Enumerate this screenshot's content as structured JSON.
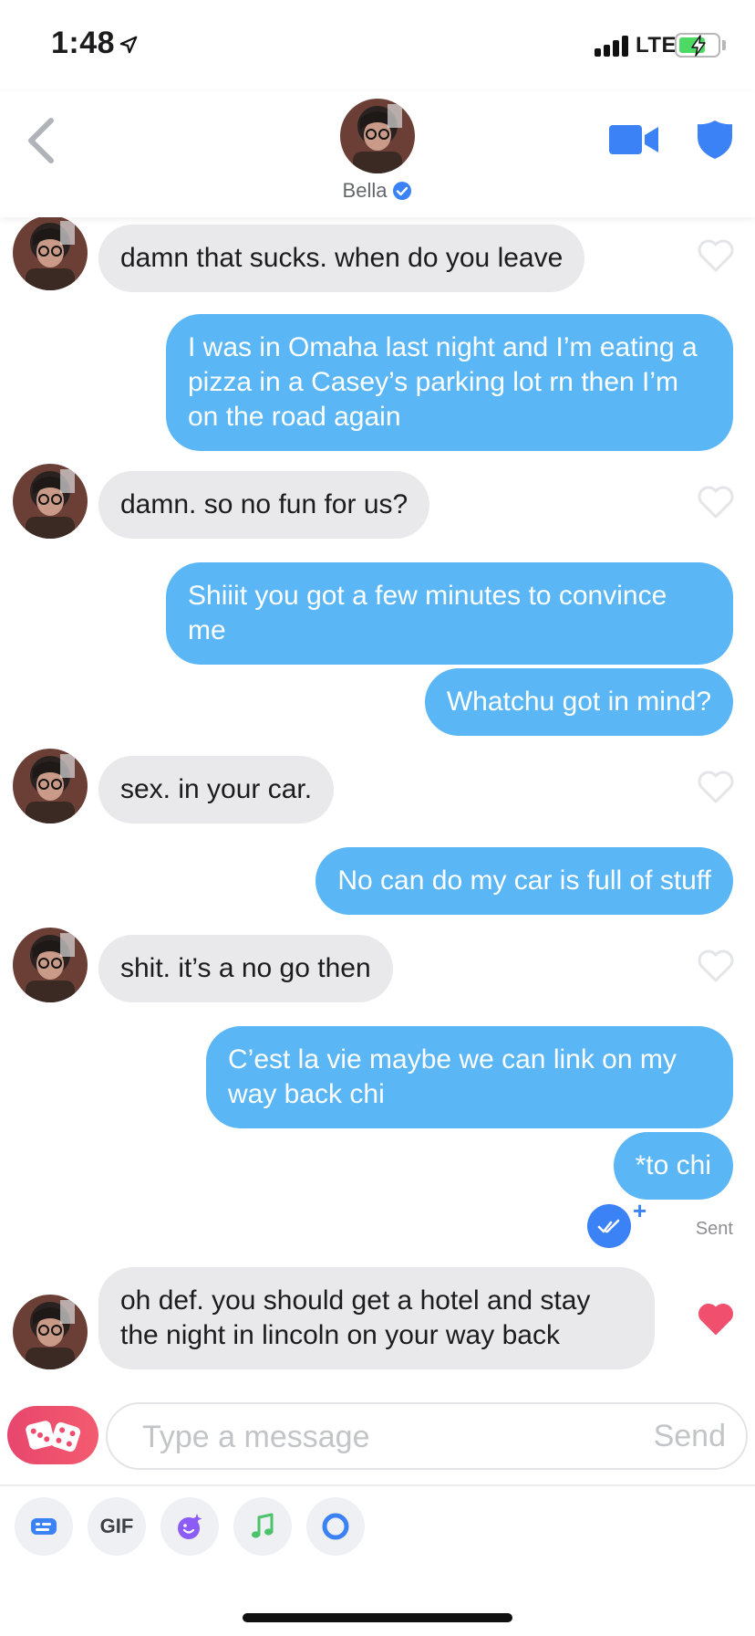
{
  "status_bar": {
    "time": "1:48",
    "network": "LTE"
  },
  "header": {
    "contact_name": "Bella"
  },
  "messages": [
    {
      "from": "them",
      "text": "damn that sucks. when do you leave",
      "liked": false
    },
    {
      "from": "me",
      "text": "I was in Omaha last night and I’m eating a pizza in a Casey’s parking lot rn then I’m on the road again"
    },
    {
      "from": "them",
      "text": "damn. so no fun for us?",
      "liked": false
    },
    {
      "from": "me",
      "text": "Shiiit you got a few minutes to convince me"
    },
    {
      "from": "me",
      "text": "Whatchu got in mind?"
    },
    {
      "from": "them",
      "text": "sex. in your car.",
      "liked": false
    },
    {
      "from": "me",
      "text": "No can do my car is full of stuff"
    },
    {
      "from": "them",
      "text": "shit. it’s a no go then",
      "liked": false
    },
    {
      "from": "me",
      "text": "C’est la vie maybe we can link on my way back chi"
    },
    {
      "from": "me",
      "text": "*to chi"
    },
    {
      "from": "them",
      "text": "oh def. you should get a hotel and stay the night in lincoln on your way back",
      "liked": true
    }
  ],
  "receipt": {
    "label": "Sent",
    "plus": "+"
  },
  "composer": {
    "placeholder": "Type a message",
    "send_label": "Send"
  },
  "tools": {
    "gif_label": "GIF"
  },
  "colors": {
    "accent_blue": "#3b82f6",
    "outgoing_bubble": "#5ab6f5",
    "incoming_bubble": "#e9e9eb",
    "liked_heart": "#f0506e"
  }
}
